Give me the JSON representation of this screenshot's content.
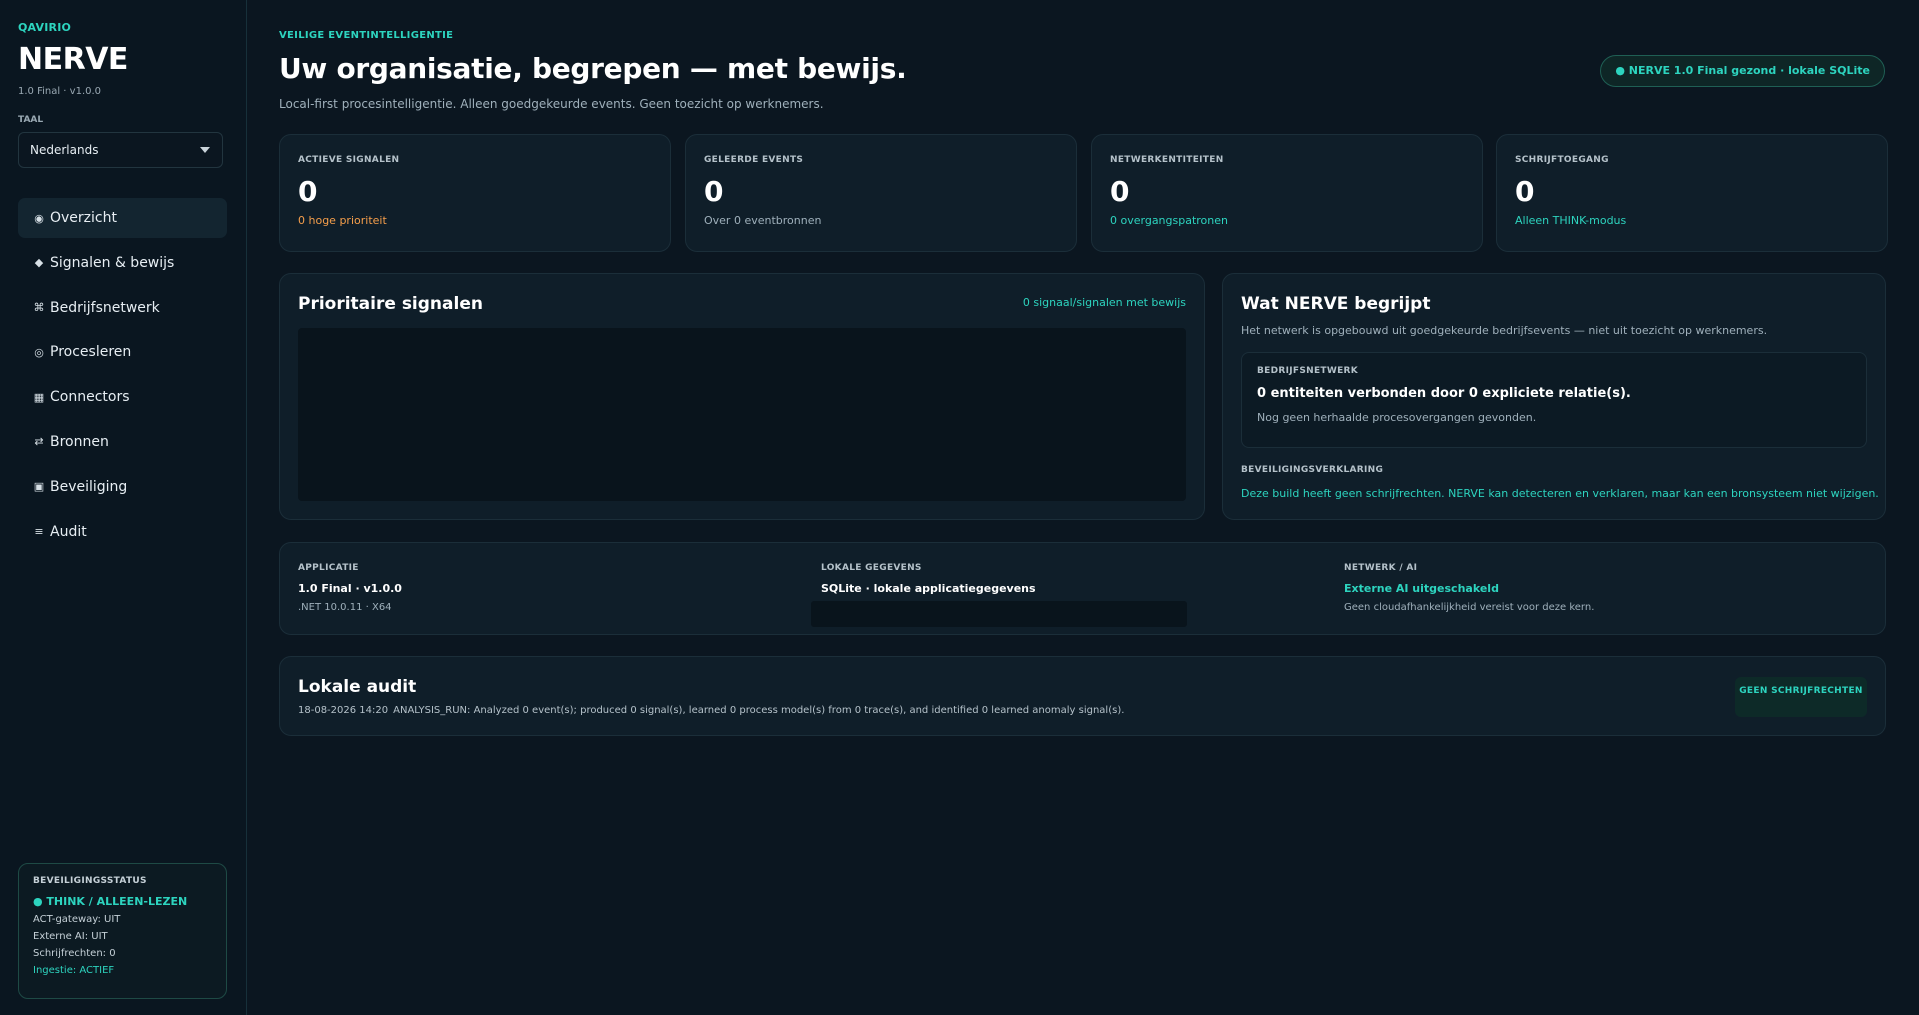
{
  "sidebar": {
    "brand": "QAVIRIO",
    "app_name": "NERVE",
    "version": "1.0 Final · v1.0.0",
    "language_label": "TAAL",
    "language_value": "Nederlands",
    "nav": [
      {
        "icon": "◉",
        "label": "Overzicht"
      },
      {
        "icon": "◆",
        "label": "Signalen & bewijs"
      },
      {
        "icon": "⌘",
        "label": "Bedrijfsnetwerk"
      },
      {
        "icon": "◎",
        "label": "Procesleren"
      },
      {
        "icon": "▦",
        "label": "Connectors"
      },
      {
        "icon": "⇄",
        "label": "Bronnen"
      },
      {
        "icon": "▣",
        "label": "Beveiliging"
      },
      {
        "icon": "≡",
        "label": "Audit"
      }
    ],
    "status": {
      "title": "BEVEILIGINGSSTATUS",
      "mode": "● THINK / ALLEEN-LEZEN",
      "act_gateway": "ACT-gateway: UIT",
      "external_ai": "Externe AI: UIT",
      "write_rights": "Schrijfrechten: 0",
      "ingestion": "Ingestie: ACTIEF"
    }
  },
  "header": {
    "eyebrow": "VEILIGE EVENTINTELLIGENTIE",
    "title": "Uw organisatie, begrepen — met bewijs.",
    "subtitle": "Local-first procesintelligentie. Alleen goedgekeurde events. Geen toezicht op werknemers.",
    "health_badge": "● NERVE 1.0 Final gezond · lokale SQLite"
  },
  "stats": [
    {
      "label": "ACTIEVE SIGNALEN",
      "value": "0",
      "sub": "0 hoge prioriteit",
      "tone": "orange"
    },
    {
      "label": "GELEERDE EVENTS",
      "value": "0",
      "sub": "Over 0 eventbronnen",
      "tone": "gray"
    },
    {
      "label": "NETWERKENTITEITEN",
      "value": "0",
      "sub": "0 overgangspatronen",
      "tone": "teal"
    },
    {
      "label": "SCHRIJFTOEGANG",
      "value": "0",
      "sub": "Alleen THINK-modus",
      "tone": "teal"
    }
  ],
  "signals": {
    "title": "Prioritaire signalen",
    "count": "0 signaal/signalen met bewijs"
  },
  "understanding": {
    "title": "Wat NERVE begrijpt",
    "subtitle": "Het netwerk is opgebouwd uit goedgekeurde bedrijfsevents — niet uit toezicht op werknemers.",
    "network_label": "BEDRIJFSNETWERK",
    "network_title": "0 entiteiten verbonden door 0 expliciete relatie(s).",
    "network_sub": "Nog geen herhaalde procesovergangen gevonden.",
    "security_label": "BEVEILIGINGSVERKLARING",
    "security_text": "Deze build heeft geen schrijfrechten. NERVE kan detecteren en verklaren, maar kan een bronsysteem niet wijzigen."
  },
  "info": {
    "app_label": "APPLICATIE",
    "app_main": "1.0 Final · v1.0.0",
    "app_sub": ".NET 10.0.11 · X64",
    "data_label": "LOKALE GEGEVENS",
    "data_main": "SQLite · lokale applicatiegegevens",
    "net_label": "NETWERK / AI",
    "net_main": "Externe AI uitgeschakeld",
    "net_sub": "Geen cloudafhankelijkheid vereist voor deze kern."
  },
  "audit": {
    "title": "Lokale audit",
    "time": "18-08-2026 14:20",
    "entry": "ANALYSIS_RUN: Analyzed 0 event(s); produced 0 signal(s), learned 0 process model(s) from 0 trace(s), and identified 0 learned anomaly signal(s).",
    "badge": "GEEN SCHRIJFRECHTEN"
  }
}
